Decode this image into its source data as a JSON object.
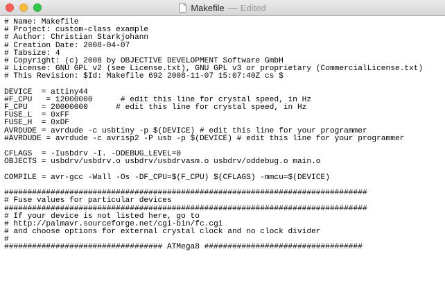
{
  "window": {
    "title": "Makefile",
    "separator": "—",
    "status": "Edited",
    "icon": "document-icon",
    "traffic_lights": {
      "close": "#fc605c",
      "minimize": "#fdbc40",
      "maximize": "#34c84a"
    }
  },
  "editor": {
    "lines": [
      "# Name: Makefile",
      "# Project: custom-class example",
      "# Author: Christian Starkjohann",
      "# Creation Date: 2008-04-07",
      "# Tabsize: 4",
      "# Copyright: (c) 2008 by OBJECTIVE DEVELOPMENT Software GmbH",
      "# License: GNU GPL v2 (see License.txt), GNU GPL v3 or proprietary (CommercialLicense.txt)",
      "# This Revision: $Id: Makefile 692 2008-11-07 15:07:40Z cs $",
      "",
      "DEVICE  = attiny44",
      "#F_CPU   = 12000000      # edit this line for crystal speed, in Hz",
      "F_CPU   = 20000000      # edit this line for crystal speed, in Hz",
      "FUSE_L  = 0xFF",
      "FUSE_H  = 0xDF",
      "AVRDUDE = avrdude -c usbtiny -p $(DEVICE) # edit this line for your programmer",
      "#AVRDUDE = avrdude -c avrisp2 -P usb -p $(DEVICE) # edit this line for your programmer",
      "",
      "CFLAGS  = -Iusbdrv -I. -DDEBUG_LEVEL=0",
      "OBJECTS = usbdrv/usbdrv.o usbdrv/usbdrvasm.o usbdrv/oddebug.o main.o",
      "",
      "COMPILE = avr-gcc -Wall -Os -DF_CPU=$(F_CPU) $(CFLAGS) -mmcu=$(DEVICE)",
      "",
      "##############################################################################",
      "# Fuse values for particular devices",
      "##############################################################################",
      "# If your device is not listed here, go to",
      "# http://palmavr.sourceforge.net/cgi-bin/fc.cgi",
      "# and choose options for external crystal clock and no clock divider",
      "#",
      "################################## ATMega8 ##################################"
    ]
  }
}
